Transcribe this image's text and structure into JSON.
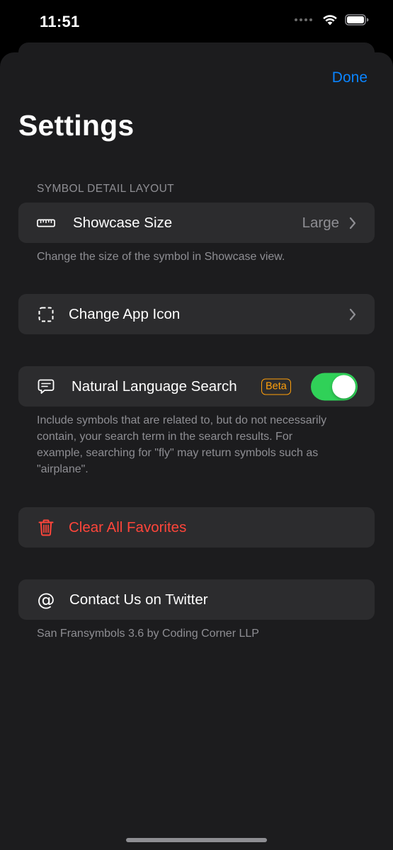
{
  "status_bar": {
    "time": "11:51"
  },
  "header": {
    "done_label": "Done",
    "title": "Settings"
  },
  "sections": {
    "layout_header": "SYMBOL DETAIL LAYOUT",
    "showcase": {
      "label": "Showcase Size",
      "value": "Large",
      "footnote": "Change the size of the symbol in Showcase view."
    },
    "app_icon": {
      "label": "Change App Icon"
    },
    "nl_search": {
      "label": "Natural Language Search",
      "badge": "Beta",
      "enabled": true,
      "footnote": "Include symbols that are related to, but do not necessarily contain, your search term in the search results. For example, searching for \"fly\" may return symbols such as \"airplane\"."
    },
    "favorites": {
      "label": "Clear All Favorites"
    },
    "twitter": {
      "label": "Contact Us on Twitter",
      "footnote": "San Fransymbols 3.6 by Coding Corner LLP"
    }
  },
  "colors": {
    "accent": "#0a84ff",
    "destructive": "#ff453a",
    "toggle_on": "#30d158",
    "badge": "#ff9f0a",
    "sheet_bg": "#1c1c1e",
    "row_bg": "#2c2c2e"
  },
  "icons": {
    "showcase": "ruler-icon",
    "app_icon": "dashed-square-icon",
    "nl_search": "text-bubble-icon",
    "favorites": "trash-icon",
    "twitter": "at-sign-icon",
    "row_chevron": "chevron-right-icon"
  }
}
